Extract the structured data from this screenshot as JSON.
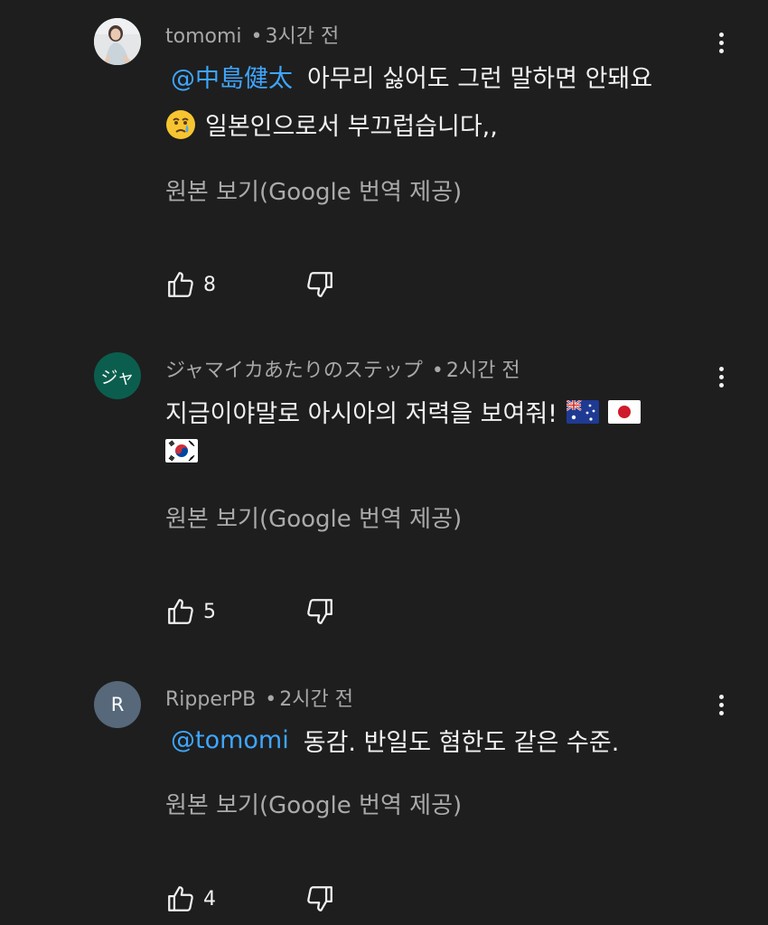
{
  "comments": [
    {
      "author": "tomomi",
      "time": "3시간 전",
      "separator": "•",
      "mention": "@中島健太",
      "text_line1": "아무리 싫어도 그런 말하면 안돼요",
      "text_line2": "일본인으로서 부끄럽습니다,,",
      "emoji": "crying-face",
      "translate_label": "원본 보기(Google 번역 제공)",
      "likes": "8",
      "avatar_type": "photo"
    },
    {
      "author": "ジャマイカあたりのステップ",
      "time": "2시간 전",
      "separator": "•",
      "avatar_text": "ジャ",
      "text_line1": "지금이야말로 아시아의 저력을 보여줘!",
      "flags": [
        "australia-flag",
        "japan-flag",
        "south-korea-flag"
      ],
      "translate_label": "원본 보기(Google 번역 제공)",
      "likes": "5",
      "avatar_color": "#0b5e4e"
    },
    {
      "author": "RipperPB",
      "time": "2시간 전",
      "separator": "•",
      "avatar_text": "R",
      "mention": "@tomomi",
      "text_line1": "동감. 반일도 혐한도 같은 수준.",
      "translate_label": "원본 보기(Google 번역 제공)",
      "likes": "4",
      "avatar_color": "#56687a"
    }
  ],
  "colors": {
    "background": "#1e1e1e",
    "mention": "#3ea6ff",
    "text": "#f1f1f1",
    "secondary": "#aaaaaa"
  },
  "icons": [
    "thumbs-up-icon",
    "thumbs-down-icon",
    "more-vert-icon"
  ]
}
